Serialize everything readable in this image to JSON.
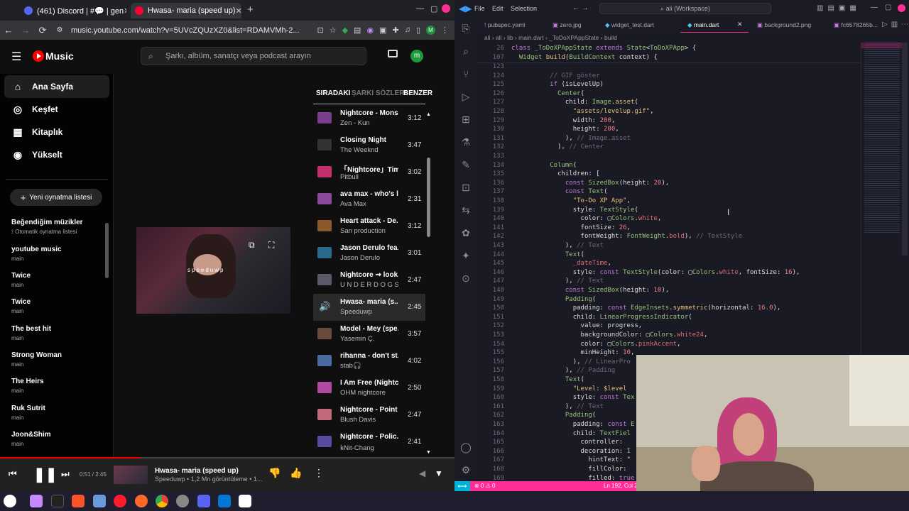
{
  "browser": {
    "tabs": [
      {
        "label": "(461) Discord | #💬 | gen",
        "color": "#5865f2"
      },
      {
        "label": "Hwasa- maria (speed up)",
        "color": "#ff0033"
      }
    ],
    "new_tab": "+",
    "url": "music.youtube.com/watch?v=5UVcZQUzXZ0&list=RDAMVMh-2..."
  },
  "ytm": {
    "logo_text": "Music",
    "search_placeholder": "Şarkı, albüm, sanatçı veya podcast arayın",
    "avatar_letter": "m",
    "nav": [
      {
        "label": "Ana Sayfa",
        "icon": "home-icon"
      },
      {
        "label": "Keşfet",
        "icon": "compass-icon"
      },
      {
        "label": "Kitaplık",
        "icon": "library-icon"
      },
      {
        "label": "Yükselt",
        "icon": "upgrade-icon"
      }
    ],
    "new_playlist": "Yeni oynatma listesi",
    "playlists": [
      {
        "title": "Beğendiğim müzikler",
        "sub": "Otomatik oynatma listesi"
      },
      {
        "title": "youtube music",
        "sub": "main"
      },
      {
        "title": "Twice",
        "sub": "main"
      },
      {
        "title": "Twice",
        "sub": "main"
      },
      {
        "title": "The best hit",
        "sub": "main"
      },
      {
        "title": "Strong Woman",
        "sub": "main"
      },
      {
        "title": "The Heirs",
        "sub": "main"
      },
      {
        "title": "Ruk Sutrit",
        "sub": "main"
      },
      {
        "title": "Joon&Shim",
        "sub": "main"
      }
    ],
    "video_overlay_text": "speeduwp",
    "queue_tabs": [
      "SIRADAKI",
      "ŞARKI SÖZLERI",
      "BENZER"
    ],
    "queue": [
      {
        "title": "Nightcore - Mons...",
        "artist": "Zen - Kun",
        "duration": "3:12",
        "color": "#7a3d8c"
      },
      {
        "title": "Closing Night",
        "artist": "The Weeknd",
        "duration": "3:47",
        "color": "#333333"
      },
      {
        "title": "「Nightcore」Timb...",
        "artist": "Pitbull",
        "duration": "3:02",
        "color": "#c2306e"
      },
      {
        "title": "ava max - who's l...",
        "artist": "Ava Max",
        "duration": "2:31",
        "color": "#8a4a9a"
      },
      {
        "title": "Heart attack - De...",
        "artist": "San production",
        "duration": "3:12",
        "color": "#8c5a2a"
      },
      {
        "title": "Jason Derulo fea...",
        "artist": "Jason Derulo",
        "duration": "3:01",
        "color": "#2a6a8c"
      },
      {
        "title": "Nightcore ⇝ look...",
        "artist": "U N D E R D O G S",
        "duration": "2:47",
        "color": "#5a5a6a"
      },
      {
        "title": "Hwasa- maria (s...",
        "artist": "Speeduwp",
        "duration": "2:45",
        "color": "#3a3a3a"
      },
      {
        "title": "Model - Mey (spe...",
        "artist": "Yasemin Ç.",
        "duration": "3:57",
        "color": "#6a4a3a"
      },
      {
        "title": "rihanna - don't st...",
        "artist": "stab🎧",
        "duration": "4:02",
        "color": "#4a6aa0"
      },
      {
        "title": "I Am Free (Nightc...",
        "artist": "OHM nightcore",
        "duration": "2:50",
        "color": "#b04aa0"
      },
      {
        "title": "Nightcore - Point ...",
        "artist": "Blush Davis",
        "duration": "2:47",
        "color": "#c06a7a"
      },
      {
        "title": "Nightcore - Polic...",
        "artist": "ꝃNit-Chang",
        "duration": "2:41",
        "color": "#5a4aa0"
      }
    ],
    "player": {
      "time": "0:51 / 2:45",
      "progress": 0.31,
      "title": "Hwasa- maria (speed up)",
      "subtitle": "Speeduwp • 1,2 Mn görüntüleme • 1..."
    }
  },
  "vscode": {
    "menu": [
      "File",
      "Edit",
      "Selection"
    ],
    "search": "ali (Workspace)",
    "tabs": [
      "pubspec.yaml",
      "zero.jpg",
      "widget_test.dart",
      "main.dart",
      "background2.png",
      "fc6578265b..."
    ],
    "breadcrumb": "ali › ali › lib › main.dart › _ToDoXPAppState › build",
    "sticky": [
      {
        "ln": "26",
        "code": [
          [
            "kw",
            "class "
          ],
          [
            "cls",
            "_ToDoXPAppState "
          ],
          [
            "kw",
            "extends "
          ],
          [
            "cls",
            "State"
          ],
          [
            "pl",
            "<"
          ],
          [
            "cls",
            "ToDoXPApp"
          ],
          [
            "pl",
            "> {"
          ]
        ]
      },
      {
        "ln": "107",
        "code": [
          [
            "pl",
            "  "
          ],
          [
            "cls",
            "Widget "
          ],
          [
            "fn",
            "build"
          ],
          [
            "pl",
            "("
          ],
          [
            "cls",
            "BuildContext "
          ],
          [
            "pl",
            "context) {"
          ]
        ]
      }
    ],
    "lines": [
      {
        "ln": "123",
        "code": []
      },
      {
        "ln": "124",
        "code": [
          [
            "cm",
            "          // GIF göster"
          ]
        ]
      },
      {
        "ln": "125",
        "code": [
          [
            "kw",
            "          if "
          ],
          [
            "pl",
            "(isLevelUp)"
          ]
        ]
      },
      {
        "ln": "126",
        "code": [
          [
            "cls",
            "            Center"
          ],
          [
            "pl",
            "("
          ]
        ]
      },
      {
        "ln": "127",
        "code": [
          [
            "pl",
            "              child: "
          ],
          [
            "cls",
            "Image"
          ],
          [
            "pl",
            "."
          ],
          [
            "fn",
            "asset"
          ],
          [
            "pl",
            "("
          ]
        ]
      },
      {
        "ln": "128",
        "code": [
          [
            "str",
            "                \"assets/levelup.gif\""
          ],
          [
            "pl",
            ","
          ]
        ]
      },
      {
        "ln": "129",
        "code": [
          [
            "pl",
            "                width: "
          ],
          [
            "num",
            "200"
          ],
          [
            "pl",
            ","
          ]
        ]
      },
      {
        "ln": "130",
        "code": [
          [
            "pl",
            "                height: "
          ],
          [
            "num",
            "200"
          ],
          [
            "pl",
            ","
          ]
        ]
      },
      {
        "ln": "131",
        "code": [
          [
            "pl",
            "              ), "
          ],
          [
            "cm",
            "// Image.asset"
          ]
        ]
      },
      {
        "ln": "132",
        "code": [
          [
            "pl",
            "            ), "
          ],
          [
            "cm",
            "// Center"
          ]
        ]
      },
      {
        "ln": "133",
        "code": []
      },
      {
        "ln": "134",
        "code": [
          [
            "cls",
            "          Column"
          ],
          [
            "pl",
            "("
          ]
        ]
      },
      {
        "ln": "135",
        "code": [
          [
            "pl",
            "            children: ["
          ]
        ]
      },
      {
        "ln": "136",
        "code": [
          [
            "kw",
            "              const "
          ],
          [
            "cls",
            "SizedBox"
          ],
          [
            "pl",
            "(height: "
          ],
          [
            "num",
            "20"
          ],
          [
            "pl",
            "),"
          ]
        ]
      },
      {
        "ln": "137",
        "code": [
          [
            "kw",
            "              const "
          ],
          [
            "cls",
            "Text"
          ],
          [
            "pl",
            "("
          ]
        ]
      },
      {
        "ln": "138",
        "code": [
          [
            "str",
            "                \"To-Do XP App\""
          ],
          [
            "pl",
            ","
          ]
        ]
      },
      {
        "ln": "139",
        "code": [
          [
            "pl",
            "                style: "
          ],
          [
            "cls",
            "TextStyle"
          ],
          [
            "pl",
            "("
          ]
        ]
      },
      {
        "ln": "140",
        "code": [
          [
            "pl",
            "                  color: ▢"
          ],
          [
            "cls",
            "Colors"
          ],
          [
            "pl",
            "."
          ],
          [
            "id",
            "white"
          ],
          [
            "pl",
            ","
          ]
        ]
      },
      {
        "ln": "141",
        "code": [
          [
            "pl",
            "                  fontSize: "
          ],
          [
            "num",
            "26"
          ],
          [
            "pl",
            ","
          ]
        ]
      },
      {
        "ln": "142",
        "code": [
          [
            "pl",
            "                  fontWeight: "
          ],
          [
            "cls",
            "FontWeight"
          ],
          [
            "pl",
            "."
          ],
          [
            "id",
            "bold"
          ],
          [
            "pl",
            "), "
          ],
          [
            "cm",
            "// TextStyle"
          ]
        ]
      },
      {
        "ln": "143",
        "code": [
          [
            "pl",
            "              ), "
          ],
          [
            "cm",
            "// Text"
          ]
        ]
      },
      {
        "ln": "144",
        "code": [
          [
            "cls",
            "              Text"
          ],
          [
            "pl",
            "("
          ]
        ]
      },
      {
        "ln": "145",
        "code": [
          [
            "id",
            "                _dateTime"
          ],
          [
            "pl",
            ","
          ]
        ]
      },
      {
        "ln": "146",
        "code": [
          [
            "pl",
            "                style: "
          ],
          [
            "kw",
            "const "
          ],
          [
            "cls",
            "TextStyle"
          ],
          [
            "pl",
            "(color: ▢"
          ],
          [
            "cls",
            "Colors"
          ],
          [
            "pl",
            "."
          ],
          [
            "id",
            "white"
          ],
          [
            "pl",
            ", fontSize: "
          ],
          [
            "num",
            "16"
          ],
          [
            "pl",
            "),"
          ]
        ]
      },
      {
        "ln": "147",
        "code": [
          [
            "pl",
            "              ), "
          ],
          [
            "cm",
            "// Text"
          ]
        ]
      },
      {
        "ln": "148",
        "code": [
          [
            "kw",
            "              const "
          ],
          [
            "cls",
            "SizedBox"
          ],
          [
            "pl",
            "(height: "
          ],
          [
            "num",
            "10"
          ],
          [
            "pl",
            "),"
          ]
        ]
      },
      {
        "ln": "149",
        "code": [
          [
            "cls",
            "              Padding"
          ],
          [
            "pl",
            "("
          ]
        ]
      },
      {
        "ln": "150",
        "code": [
          [
            "pl",
            "                padding: "
          ],
          [
            "kw",
            "const "
          ],
          [
            "cls",
            "EdgeInsets"
          ],
          [
            "pl",
            "."
          ],
          [
            "fn",
            "symmetric"
          ],
          [
            "pl",
            "(horizontal: "
          ],
          [
            "num",
            "16.0"
          ],
          [
            "pl",
            "),"
          ]
        ]
      },
      {
        "ln": "151",
        "code": [
          [
            "pl",
            "                child: "
          ],
          [
            "cls",
            "LinearProgressIndicator"
          ],
          [
            "pl",
            "("
          ]
        ]
      },
      {
        "ln": "152",
        "code": [
          [
            "pl",
            "                  value: progress,"
          ]
        ]
      },
      {
        "ln": "153",
        "code": [
          [
            "pl",
            "                  backgroundColor: ▢"
          ],
          [
            "cls",
            "Colors"
          ],
          [
            "pl",
            "."
          ],
          [
            "id",
            "white24"
          ],
          [
            "pl",
            ","
          ]
        ]
      },
      {
        "ln": "154",
        "code": [
          [
            "pl",
            "                  color: ▢"
          ],
          [
            "cls",
            "Colors"
          ],
          [
            "pl",
            "."
          ],
          [
            "id",
            "pinkAccent"
          ],
          [
            "pl",
            ","
          ]
        ]
      },
      {
        "ln": "155",
        "code": [
          [
            "pl",
            "                  minHeight: "
          ],
          [
            "num",
            "10"
          ],
          [
            "pl",
            ","
          ]
        ]
      },
      {
        "ln": "156",
        "code": [
          [
            "pl",
            "                ), "
          ],
          [
            "cm",
            "// LinearPro"
          ]
        ]
      },
      {
        "ln": "157",
        "code": [
          [
            "pl",
            "              ), "
          ],
          [
            "cm",
            "// Padding"
          ]
        ]
      },
      {
        "ln": "158",
        "code": [
          [
            "cls",
            "              Text"
          ],
          [
            "pl",
            "("
          ]
        ]
      },
      {
        "ln": "159",
        "code": [
          [
            "str",
            "                \"Level: $level"
          ]
        ]
      },
      {
        "ln": "160",
        "code": [
          [
            "pl",
            "                style: "
          ],
          [
            "kw",
            "const "
          ],
          [
            "cls",
            "Tex"
          ]
        ]
      },
      {
        "ln": "161",
        "code": [
          [
            "pl",
            "              ), "
          ],
          [
            "cm",
            "// Text"
          ]
        ]
      },
      {
        "ln": "162",
        "code": [
          [
            "cls",
            "              Padding"
          ],
          [
            "pl",
            "("
          ]
        ]
      },
      {
        "ln": "163",
        "code": [
          [
            "pl",
            "                padding: "
          ],
          [
            "kw",
            "const "
          ],
          [
            "cls",
            "E"
          ]
        ]
      },
      {
        "ln": "164",
        "code": [
          [
            "pl",
            "                child: "
          ],
          [
            "cls",
            "TextFiel"
          ]
        ]
      },
      {
        "ln": "165",
        "code": [
          [
            "pl",
            "                  controller: "
          ]
        ]
      },
      {
        "ln": "166",
        "code": [
          [
            "pl",
            "                  decoration: "
          ],
          [
            "cls",
            "I"
          ]
        ]
      },
      {
        "ln": "167",
        "code": [
          [
            "pl",
            "                    hintText: \""
          ]
        ]
      },
      {
        "ln": "168",
        "code": [
          [
            "pl",
            "                    fillColor: "
          ]
        ]
      },
      {
        "ln": "169",
        "code": [
          [
            "pl",
            "                    filled: "
          ],
          [
            "kw",
            "true"
          ]
        ]
      }
    ],
    "status": {
      "left": "⊗ 0 ⚠ 0",
      "right": "Ln 192, Col 2"
    }
  }
}
